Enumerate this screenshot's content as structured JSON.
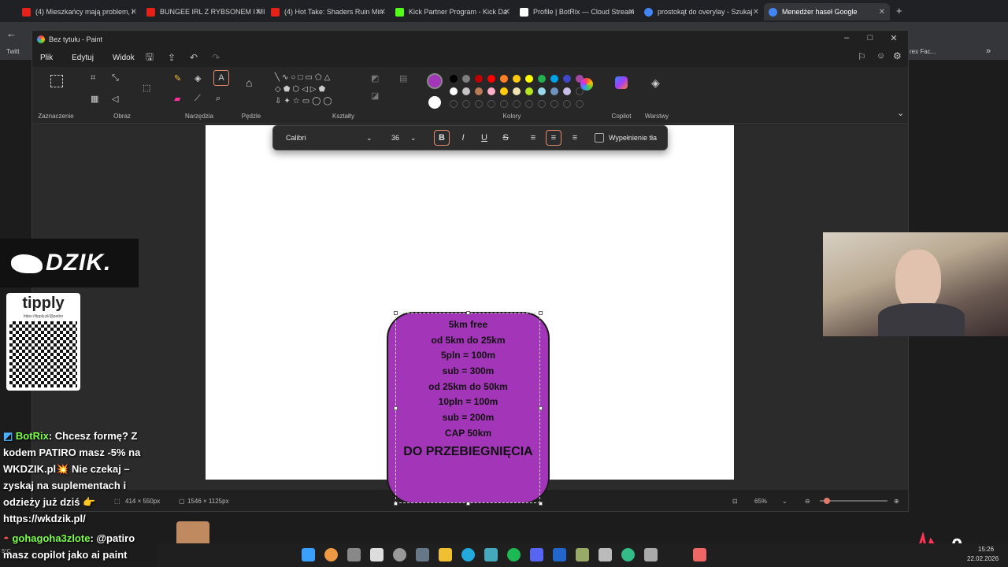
{
  "browser": {
    "tabs": [
      {
        "label": "(4) Mieszkańcy mają problem, i",
        "icon": "youtube-icon",
        "color": "#e62117"
      },
      {
        "label": "BUNGEE IRL Z RYBSONEM I MI",
        "icon": "youtube-icon",
        "color": "#e62117"
      },
      {
        "label": "(4) Hot Take: Shaders Ruin Min",
        "icon": "youtube-icon",
        "color": "#e62117"
      },
      {
        "label": "Kick Partner Program - Kick Da",
        "icon": "kick-icon",
        "color": "#53fc18"
      },
      {
        "label": "Profile | BotRix — Cloud Stream",
        "icon": "botrix-icon",
        "color": "#ffffff"
      },
      {
        "label": "prostokąt do overylay - Szukaj",
        "icon": "google-icon",
        "color": "#4285f4"
      },
      {
        "label": "Menedżer haseł Google",
        "icon": "google-icon",
        "color": "#4285f4"
      }
    ],
    "bookmarks_left": "Twitt",
    "bookmarks_right": "rex Fac..."
  },
  "paint": {
    "title": "Bez tytułu - Paint",
    "menu": [
      "Plik",
      "Edytuj",
      "Widok"
    ],
    "groups": [
      "Zaznaczenie",
      "Obraz",
      "Narzędzia",
      "Pędzle",
      "Kształty",
      "Kolory",
      "Copilot",
      "Warstwy"
    ],
    "colors": {
      "primary": "#a335b8",
      "secondary": "#ffffff",
      "row1": [
        "#000000",
        "#7f7f7f",
        "#c00000",
        "#ff0000",
        "#ff7f27",
        "#ffc90e",
        "#ffff00",
        "#22b14c",
        "#00a2e8",
        "#3f48cc",
        "#a349a4"
      ],
      "row2": [
        "#ffffff",
        "#c3c3c3",
        "#b97a57",
        "#ffaec9",
        "#ffc90e",
        "#efe4b0",
        "#b5e61d",
        "#99d9ea",
        "#7092be",
        "#c8bfe7"
      ]
    },
    "textbar": {
      "font": "Calibri",
      "size": "36",
      "fill_label": "Wypełnienie tła"
    },
    "shape_lines": [
      "5km free",
      "od 5km do 25km",
      "5pln = 100m",
      "sub = 300m",
      "od 25km do 50km",
      "10pln = 100m",
      "sub = 200m",
      "CAP 50km"
    ],
    "shape_big_line": "DO PRZEBIEGNIĘCIA",
    "status": {
      "selection_size": "414 × 550px",
      "canvas_size": "1546 × 1125px",
      "zoom": "65%"
    }
  },
  "overlay": {
    "brand": "DZIK.",
    "tipply_title": "tipply",
    "tipply_url": "https://tipply.pl/@patiro",
    "chat": [
      {
        "user": "BotRix",
        "text": ": Chcesz formę? Z kodem PATIRO masz -5% na WKDZIK.pl💥 Nie czekaj – zyskaj na suplementach i odzieży już dziś 👉 https://wkdzik.pl/"
      },
      {
        "user": "gohagoha3zlote",
        "text": ": @patiro masz copilot jako ai paint"
      }
    ],
    "counter": "0"
  },
  "system": {
    "time": "15:26",
    "date": "22.02.2026",
    "temp": "5°C"
  }
}
